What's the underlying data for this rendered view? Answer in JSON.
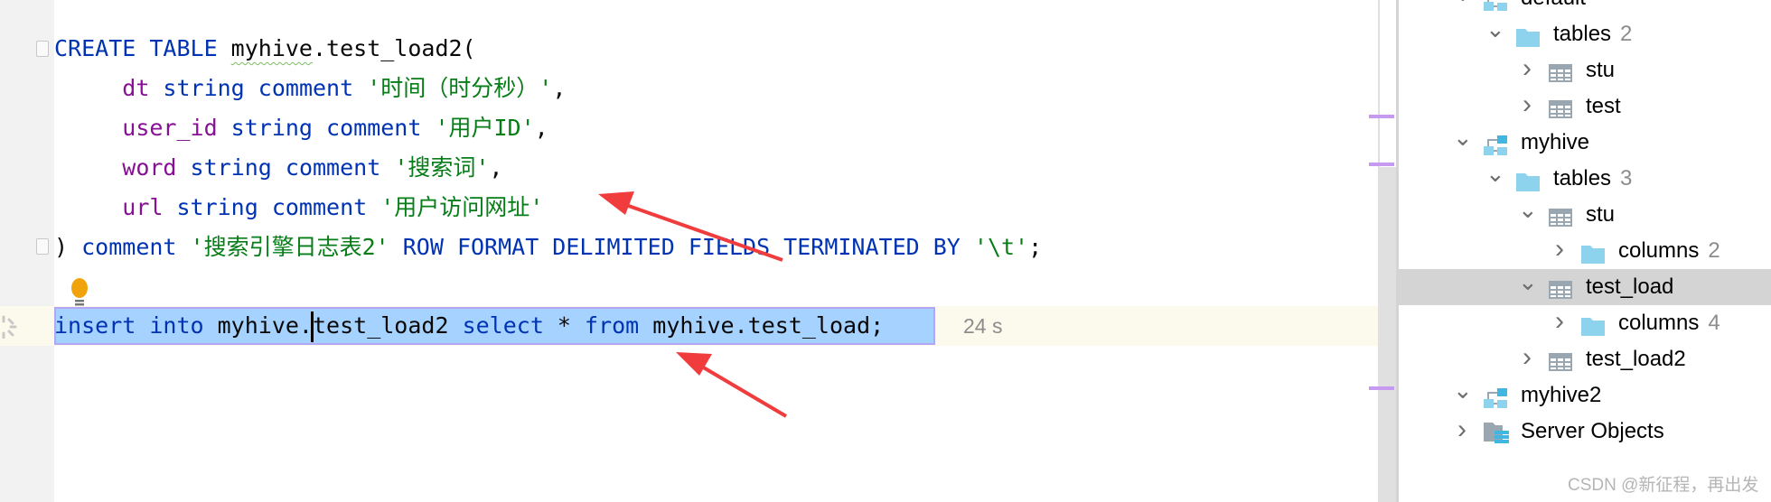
{
  "editor": {
    "lines": [
      {
        "parts": [
          [
            "kw",
            "CREATE TABLE "
          ],
          [
            "wavy",
            "myhive"
          ],
          [
            "",
            "."
          ],
          [
            "",
            "test_load2("
          ]
        ]
      },
      {
        "parts": [
          [
            "",
            "     "
          ],
          [
            "id",
            "dt"
          ],
          [
            "kw",
            " string comment "
          ],
          [
            "str",
            "'时间（时分秒）'"
          ],
          [
            "",
            ","
          ]
        ]
      },
      {
        "parts": [
          [
            "",
            "     "
          ],
          [
            "id",
            "user_id"
          ],
          [
            "kw",
            " string comment "
          ],
          [
            "str",
            "'用户ID'"
          ],
          [
            "",
            ","
          ]
        ]
      },
      {
        "parts": [
          [
            "",
            "     "
          ],
          [
            "id",
            "word"
          ],
          [
            "kw",
            " string comment "
          ],
          [
            "str",
            "'搜索词'"
          ],
          [
            "",
            ","
          ]
        ]
      },
      {
        "parts": [
          [
            "",
            "     "
          ],
          [
            "id",
            "url"
          ],
          [
            "kw",
            " string comment "
          ],
          [
            "str",
            "'用户访问网址'"
          ]
        ]
      },
      {
        "parts": [
          [
            "",
            ") "
          ],
          [
            "kw",
            "comment "
          ],
          [
            "str",
            "'搜索引擎日志表2'"
          ],
          [
            "kw",
            " ROW FORMAT DELIMITED FIELDS TERMINATED BY "
          ],
          [
            "str",
            "'\\t'"
          ],
          [
            "",
            ";"
          ]
        ]
      }
    ],
    "insert_before_caret": [
      [
        "kw",
        "insert into "
      ],
      [
        "",
        "myhive."
      ]
    ],
    "insert_after_caret": [
      [
        "",
        "test_load2 "
      ],
      [
        "kw",
        "select "
      ],
      [
        "",
        "* "
      ],
      [
        "kw",
        "from "
      ],
      [
        "",
        "myhive.test_load;"
      ]
    ],
    "timing": "24 s"
  },
  "tree": {
    "items": [
      {
        "label": "default",
        "level": 1,
        "icon": "schema-icon",
        "chevron": "down"
      },
      {
        "label": "tables",
        "count": "2",
        "level": 2,
        "icon": "folder-icon",
        "chevron": "down"
      },
      {
        "label": "stu",
        "level": 3,
        "icon": "table-icon",
        "chevron": "right"
      },
      {
        "label": "test",
        "level": 3,
        "icon": "table-icon",
        "chevron": "right"
      },
      {
        "label": "myhive",
        "level": 1,
        "icon": "schema-icon",
        "chevron": "down"
      },
      {
        "label": "tables",
        "count": "3",
        "level": 2,
        "icon": "folder-icon",
        "chevron": "down"
      },
      {
        "label": "stu",
        "level": 3,
        "icon": "table-icon",
        "chevron": "down"
      },
      {
        "label": "columns",
        "count": "2",
        "level": 4,
        "icon": "folder-icon",
        "chevron": "right"
      },
      {
        "label": "test_load",
        "level": 3,
        "icon": "table-icon",
        "chevron": "down",
        "selected": true
      },
      {
        "label": "columns",
        "count": "4",
        "level": 4,
        "icon": "folder-icon",
        "chevron": "right"
      },
      {
        "label": "test_load2",
        "level": 3,
        "icon": "table-icon",
        "chevron": "right"
      },
      {
        "label": "myhive2",
        "level": 1,
        "icon": "schema-icon",
        "chevron": "down"
      },
      {
        "label": "Server Objects",
        "level": 1,
        "icon": "server-objects-icon",
        "chevron": "right"
      }
    ]
  },
  "watermark": "CSDN @新征程，再出发",
  "colors": {
    "keyword": "#0033b3",
    "identifier": "#871094",
    "string": "#067d17",
    "selection": "#a6d2ff",
    "arrow": "#f03c3c",
    "icon": "#8dd3ee"
  }
}
